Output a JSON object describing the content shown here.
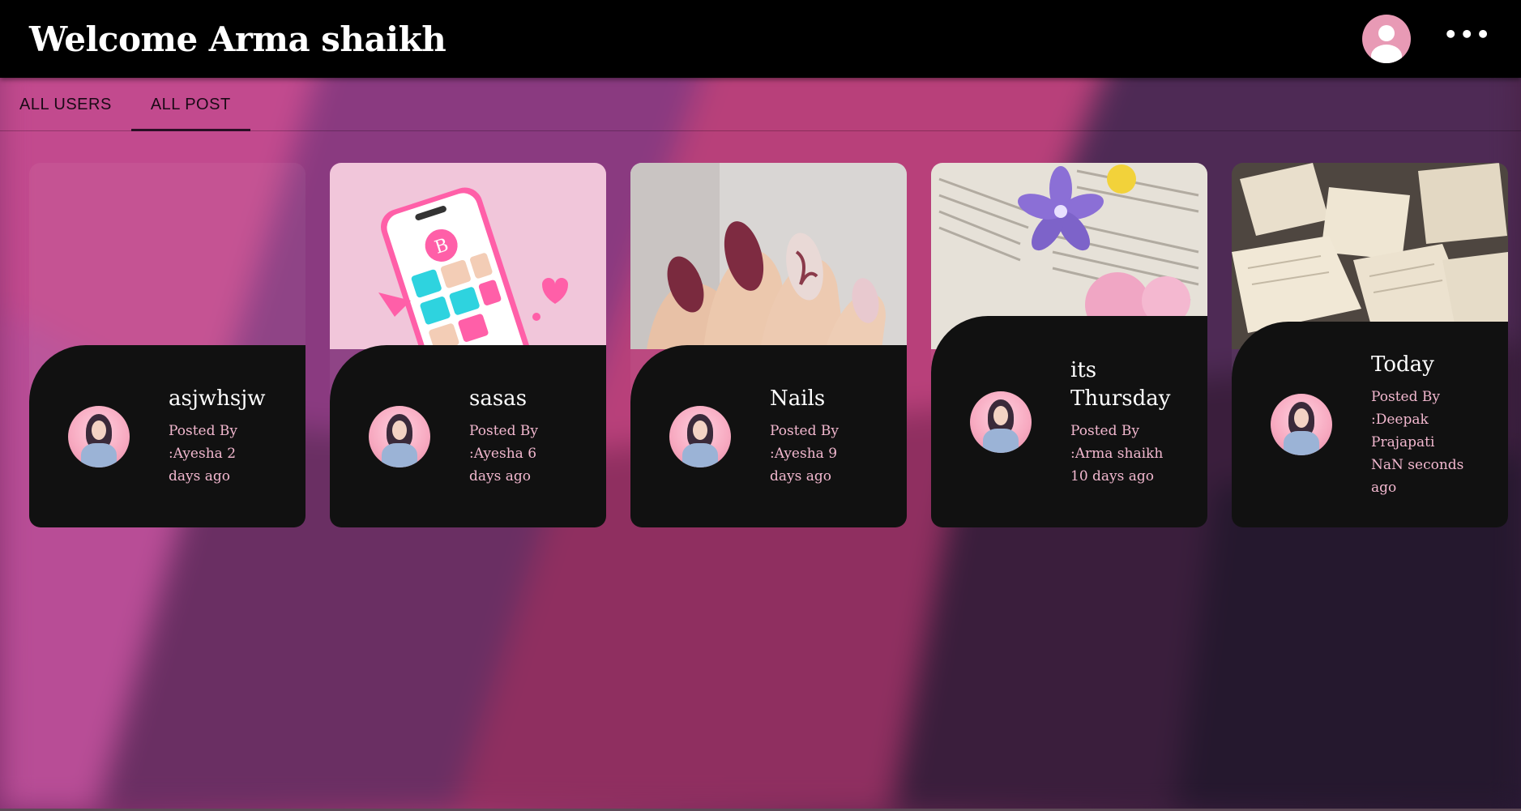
{
  "header": {
    "title": "Welcome Arma shaikh"
  },
  "tabs": [
    {
      "label": "ALL USERS",
      "active": false
    },
    {
      "label": "ALL POST",
      "active": true
    }
  ],
  "posts": [
    {
      "title": "asjwhsjw",
      "meta": "Posted By :Ayesha 2 days ago",
      "image": "none"
    },
    {
      "title": "sasas",
      "meta": "Posted By :Ayesha 6 days ago",
      "image": "phone-app-illustration"
    },
    {
      "title": "Nails",
      "meta": "Posted By :Ayesha 9 days ago",
      "image": "manicured-nails-photo"
    },
    {
      "title": "its Thursday",
      "meta": "Posted By :Arma shaikh 10 days ago",
      "image": "book-with-flowers-photo"
    },
    {
      "title": "Today",
      "meta": "Posted By :Deepak Prajapati NaN seconds ago",
      "image": "open-books-photo"
    }
  ],
  "colors": {
    "accent_pink": "#e89ab5",
    "card_panel": "#111111",
    "meta_text": "#f2b8cf"
  }
}
